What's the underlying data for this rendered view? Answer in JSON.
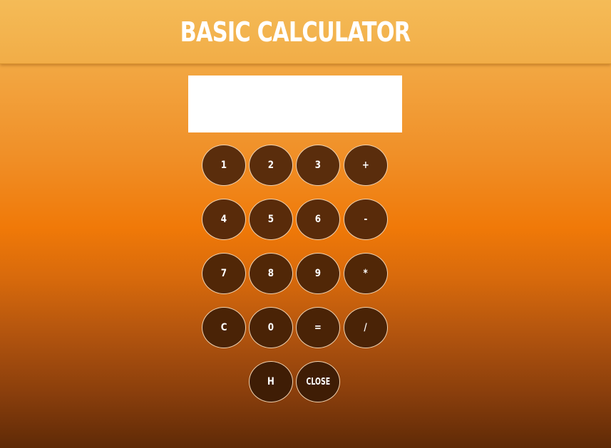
{
  "header": {
    "title": "BASIC CALCULATOR"
  },
  "display": {
    "value": ""
  },
  "keys": [
    [
      "1",
      "2",
      "3",
      "+"
    ],
    [
      "4",
      "5",
      "6",
      "-"
    ],
    [
      "7",
      "8",
      "9",
      "*"
    ],
    [
      "C",
      "0",
      "=",
      "/"
    ],
    [
      "H",
      "CLOSE"
    ]
  ],
  "colors": {
    "header_bg": "#f4b550",
    "page_gradient_top": "#f5b753",
    "page_gradient_mid": "#f07908",
    "page_gradient_bottom": "#5f2a07",
    "key_bg": "#5a2d0c",
    "key_border": "#f0d2b0",
    "key_text": "#ffffff",
    "title_text": "#ffffff",
    "display_bg": "#ffffff"
  }
}
